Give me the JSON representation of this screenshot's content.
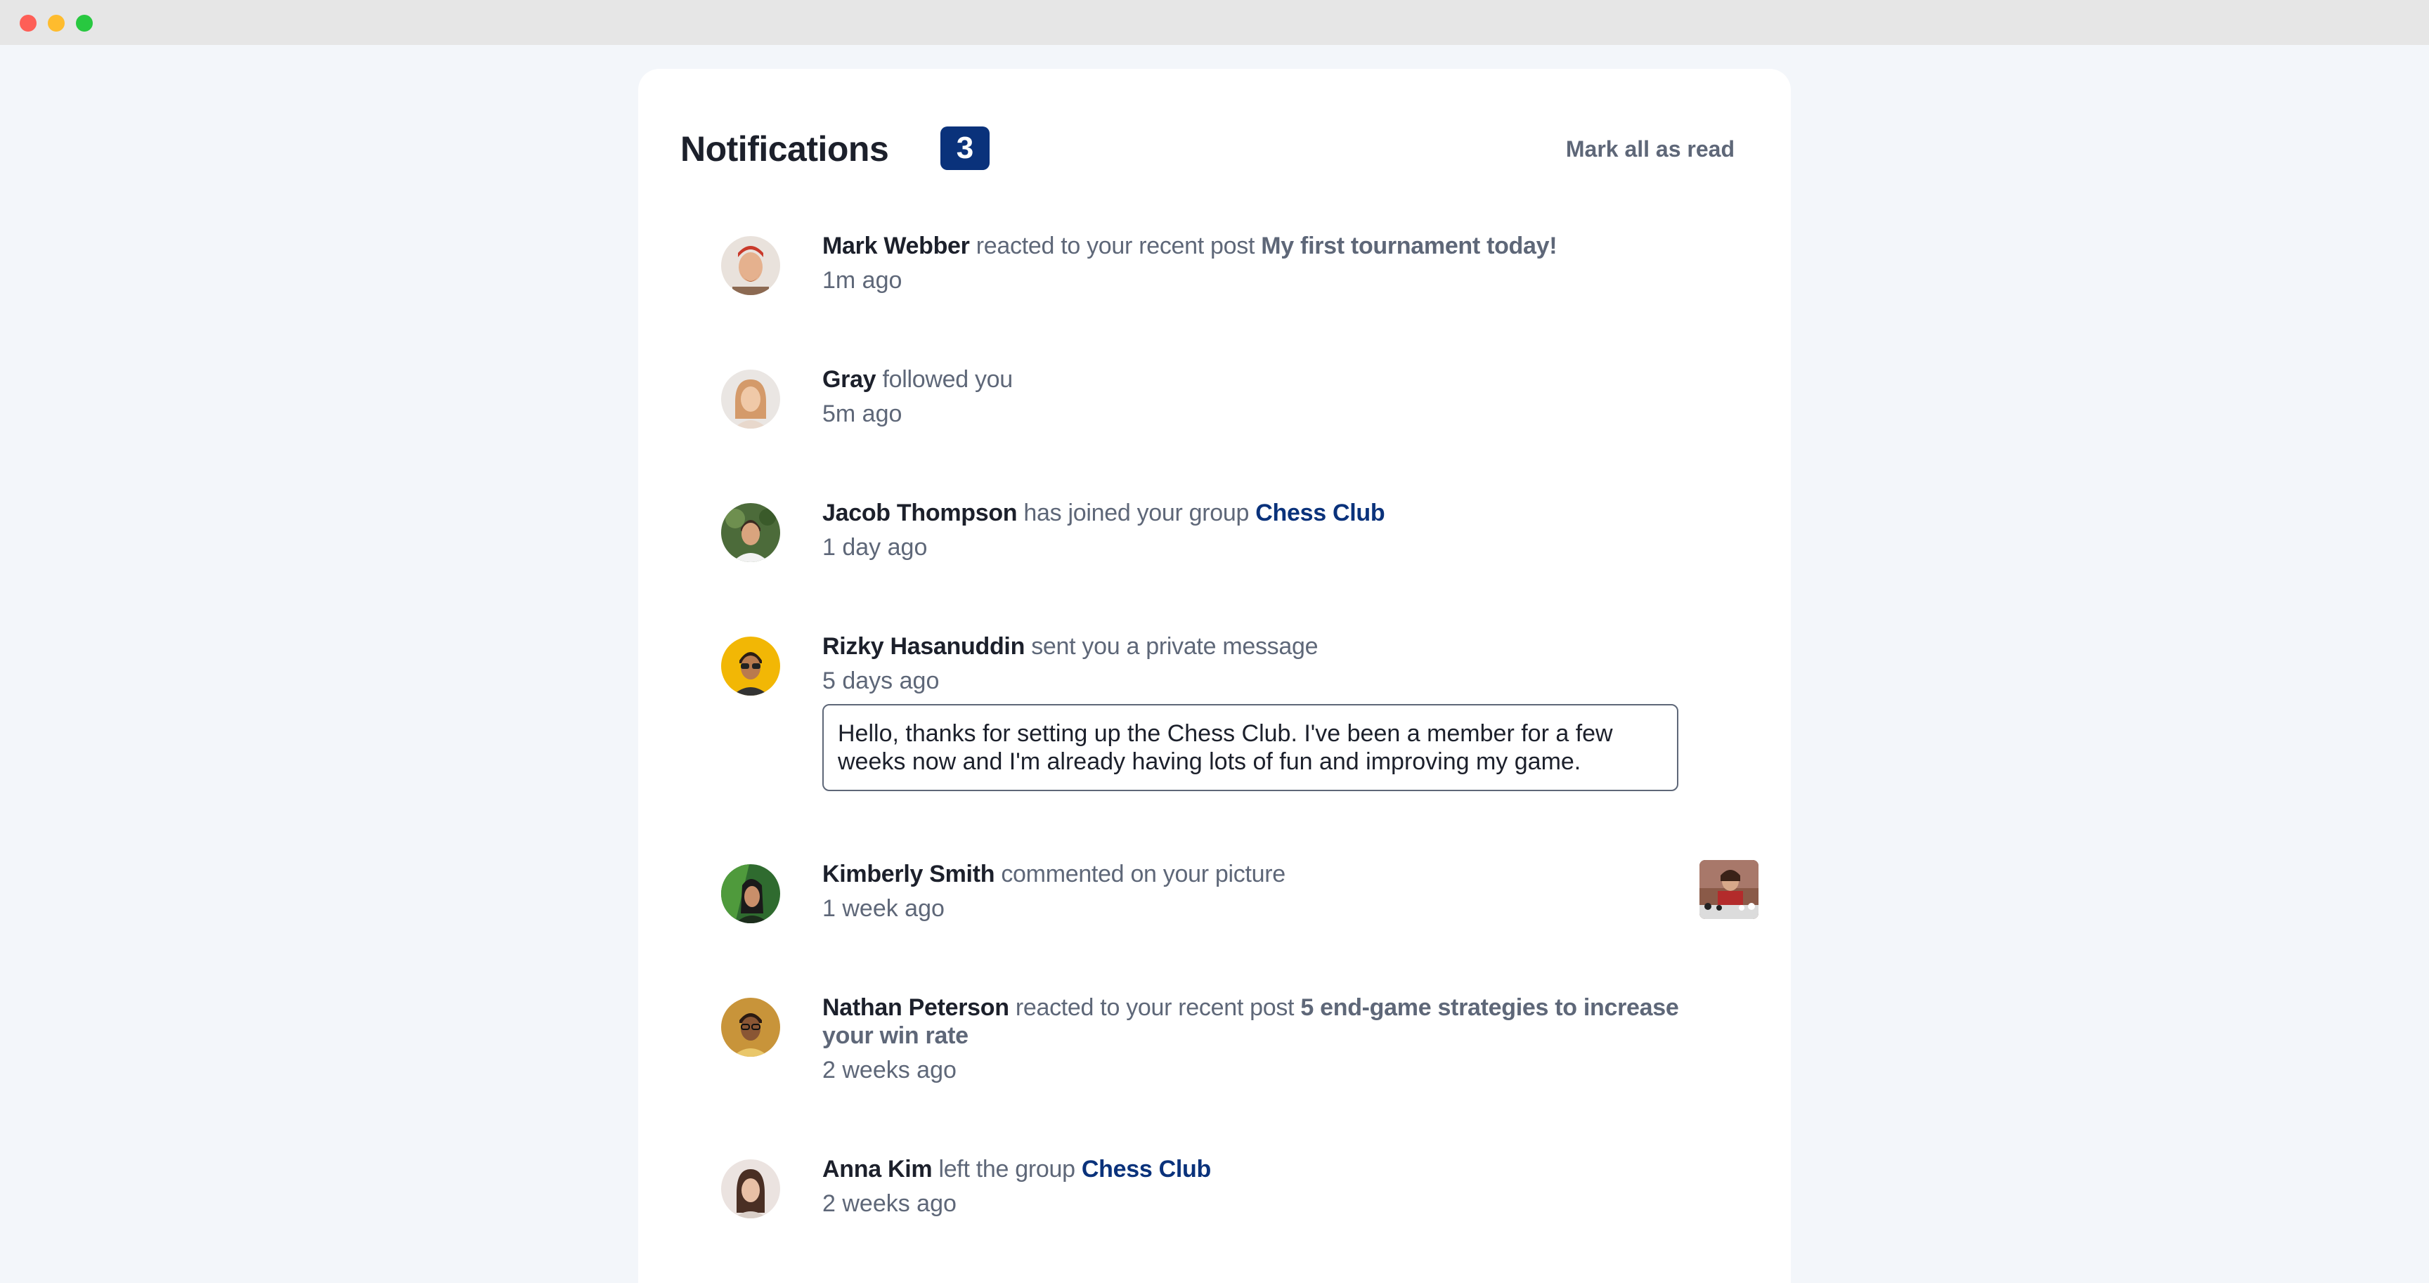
{
  "header": {
    "title": "Notifications",
    "badge_count": "3",
    "mark_all_label": "Mark all as read"
  },
  "notifications": [
    {
      "name": "Mark Webber",
      "action": "reacted to your recent post",
      "target": "My first tournament today!",
      "target_type": "post",
      "time": "1m ago",
      "avatar_icon": "avatar-mark-webber"
    },
    {
      "name": "Gray",
      "action": "followed you",
      "target": "",
      "target_type": "none",
      "time": "5m ago",
      "avatar_icon": "avatar-gray"
    },
    {
      "name": "Jacob Thompson",
      "action": "has joined your group",
      "target": "Chess Club",
      "target_type": "group",
      "time": "1 day ago",
      "avatar_icon": "avatar-jacob-thompson"
    },
    {
      "name": "Rizky Hasanuddin",
      "action": "sent you a private message",
      "target": "",
      "target_type": "none",
      "time": "5 days ago",
      "message": "Hello, thanks for setting up the Chess Club. I've been a member for a few weeks now and I'm already having lots of fun and improving my game.",
      "avatar_icon": "avatar-rizky-hasanuddin"
    },
    {
      "name": "Kimberly Smith",
      "action": "commented on your picture",
      "target": "",
      "target_type": "none",
      "time": "1 week ago",
      "picture_icon": "chess-picture-thumbnail",
      "avatar_icon": "avatar-kimberly-smith"
    },
    {
      "name": "Nathan Peterson",
      "action": "reacted to your recent post",
      "target": "5 end-game strategies to increase your win rate",
      "target_type": "post",
      "time": "2 weeks ago",
      "avatar_icon": "avatar-nathan-peterson"
    },
    {
      "name": "Anna Kim",
      "action": "left the group",
      "target": "Chess Club",
      "target_type": "group",
      "time": "2 weeks ago",
      "avatar_icon": "avatar-anna-kim"
    }
  ],
  "colors": {
    "page_bg": "#f3f6fa",
    "card_bg": "#ffffff",
    "title_text": "#1c202b",
    "body_text": "#5e6778",
    "badge_bg": "#0a327b",
    "group_link": "#0a327b",
    "titlebar_bg": "#e6e6e6"
  }
}
